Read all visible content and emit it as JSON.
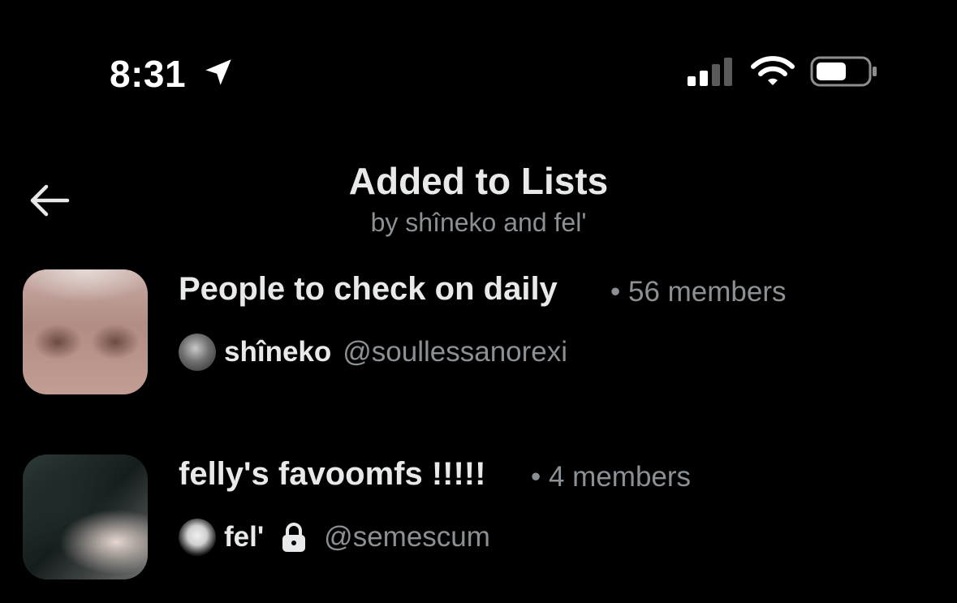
{
  "status_bar": {
    "time": "8:31",
    "icons": [
      "location-arrow-icon",
      "cellular-signal-icon",
      "wifi-icon",
      "battery-icon"
    ]
  },
  "header": {
    "back_icon": "back-arrow-icon",
    "title": "Added to Lists",
    "subtitle": "by shîneko and fel'"
  },
  "lists": [
    {
      "name": "People to check on daily",
      "meta": "• 56 members",
      "owner_name": "shîneko",
      "owner_handle": "@soullessanorexi",
      "locked": false
    },
    {
      "name": "felly's favoomfs !!!!!",
      "meta": "• 4 members",
      "owner_name": "fel'",
      "owner_handle": "@semescum",
      "locked": true
    }
  ],
  "colors": {
    "background": "#000000",
    "primary_text": "#e7e9ea",
    "secondary_text": "#8b9095"
  }
}
